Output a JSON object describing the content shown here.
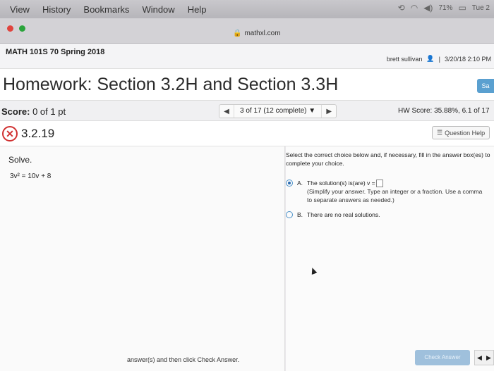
{
  "menubar": {
    "items": [
      "View",
      "History",
      "Bookmarks",
      "Window",
      "Help"
    ],
    "status": {
      "battery": "71%",
      "clock": "Tue 2"
    }
  },
  "browser": {
    "url": "mathxl.com"
  },
  "course": {
    "title": "MATH 101S 70 Spring 2018",
    "user": "brett sullivan",
    "datetime": "3/20/18 2:10 PM"
  },
  "homework": {
    "title": "Homework: Section 3.2H and Section 3.3H",
    "save_label": "Sa"
  },
  "scorebar": {
    "score_label": "Score:",
    "score_value": "0 of 1 pt",
    "pager_text": "3 of 17 (12 complete)",
    "hw_score": "HW Score: 35.88%, 6.1 of 17"
  },
  "question": {
    "number": "3.2.19",
    "help_label": "Question Help",
    "prompt": "Solve.",
    "equation": "3v² = 10v + 8",
    "instruction": "Select the correct choice below and, if necessary, fill in the answer box(es) to complete your choice.",
    "option_a_label": "A.",
    "option_a_text": "The solution(s) is(are) v =",
    "option_a_hint": "(Simplify your answer. Type an integer or a fraction. Use a comma to separate answers as needed.)",
    "option_b_label": "B.",
    "option_b_text": "There are no real solutions."
  },
  "footer": {
    "instruction": "answer(s) and then click Check Answer.",
    "check_label": "Check Answer"
  }
}
